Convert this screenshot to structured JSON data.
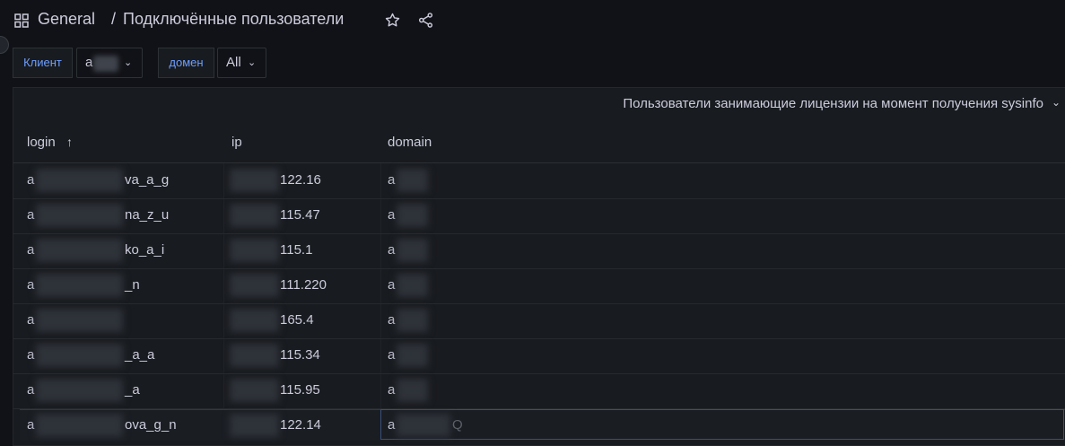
{
  "header": {
    "folder": "General",
    "separator": "/",
    "title": "Подключённые пользователи",
    "icons": [
      "grid-icon",
      "star-icon",
      "share-icon"
    ]
  },
  "variables": {
    "client_label": "Клиент",
    "client_value": "a",
    "domain_label": "домен",
    "domain_value": "All"
  },
  "panel": {
    "title": "Пользователи занимающие лицензии на момент получения sysinfo"
  },
  "table": {
    "columns": [
      "login",
      "ip",
      "domain"
    ],
    "sort_column": "login",
    "sort_direction": "ascending",
    "rows": [
      {
        "login_start": "a",
        "login_end": "va_a_g",
        "ip_end": "122.16",
        "domain_start": "a",
        "domain_end": ""
      },
      {
        "login_start": "a",
        "login_end": "na_z_u",
        "ip_end": "115.47",
        "domain_start": "a",
        "domain_end": ""
      },
      {
        "login_start": "a",
        "login_end": "ko_a_i",
        "ip_end": "115.1",
        "domain_start": "a",
        "domain_end": ""
      },
      {
        "login_start": "a",
        "login_end": "_n",
        "ip_end": "111.220",
        "domain_start": "a",
        "domain_end": ""
      },
      {
        "login_start": "a",
        "login_end": "",
        "ip_end": "165.4",
        "domain_start": "a",
        "domain_end": ""
      },
      {
        "login_start": "a",
        "login_end": "_a_a",
        "ip_end": "115.34",
        "domain_start": "a",
        "domain_end": ""
      },
      {
        "login_start": "a",
        "login_end": "_a",
        "ip_end": "115.95",
        "domain_start": "a",
        "domain_end": ""
      },
      {
        "login_start": "a",
        "login_end": "ova_g_n",
        "ip_end": "122.14",
        "domain_start": "a",
        "domain_end": "Q"
      }
    ]
  },
  "colors": {
    "background": "#111217",
    "panel": "#181b1f",
    "text": "#ccccdc",
    "variable_label": "#6e9fff"
  }
}
